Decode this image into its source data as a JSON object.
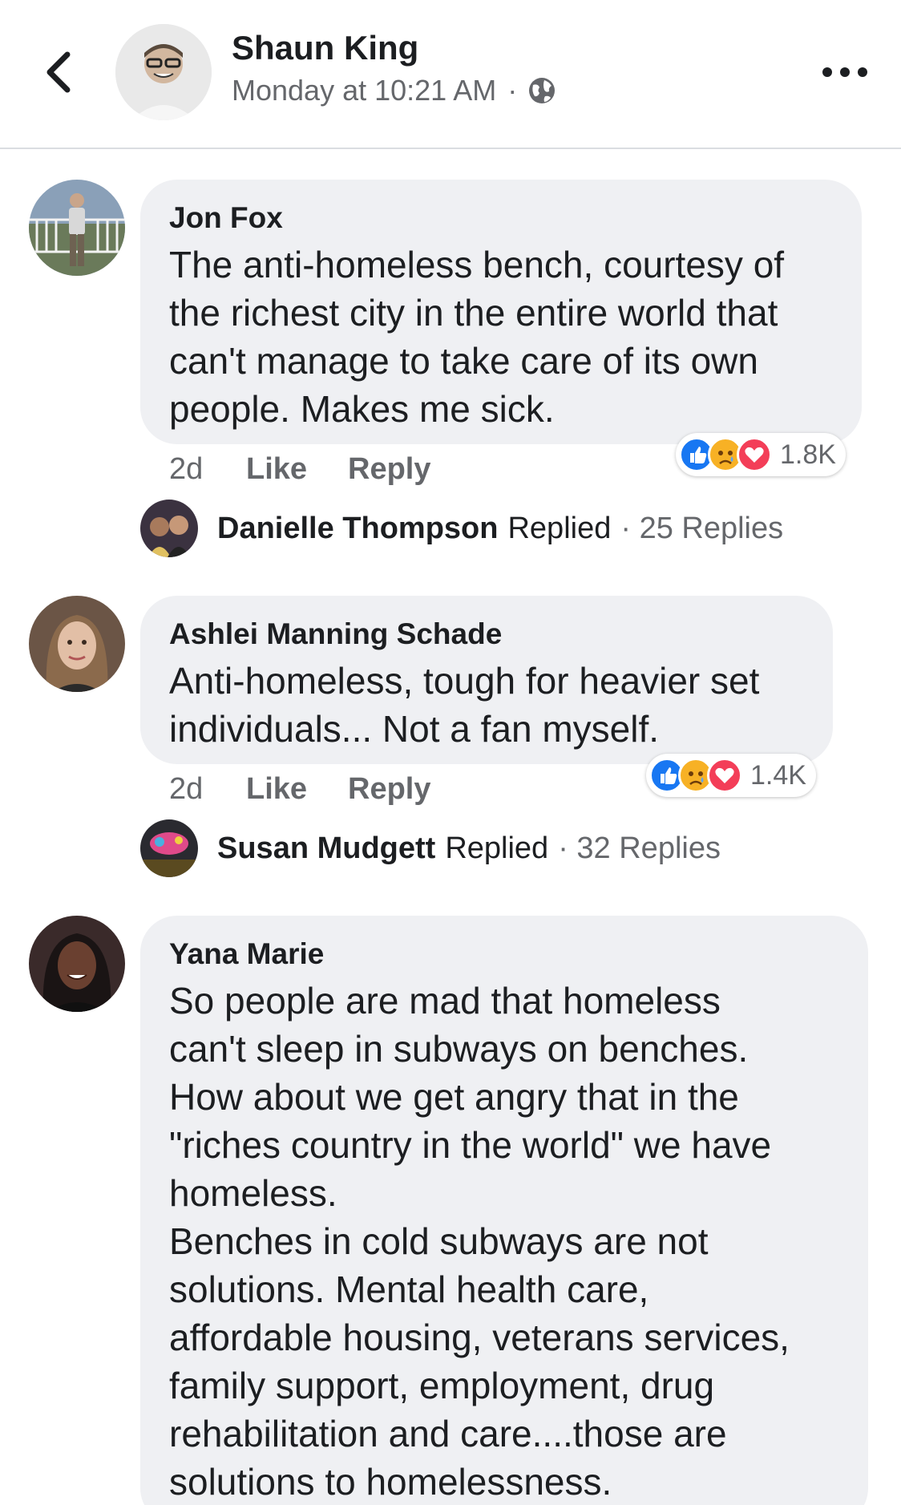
{
  "header": {
    "back_icon": "chevron-left-icon",
    "author": "Shaun King",
    "timestamp": "Monday at 10:21 AM",
    "separator": "·",
    "privacy_icon": "globe-icon",
    "more_icon": "more-horizontal-icon"
  },
  "comments": [
    {
      "author": "Jon Fox",
      "text": "The anti-homeless bench, courtesy of the richest city in the entire world that can't manage to take care of its own people. Makes me sick.",
      "age": "2d",
      "like_label": "Like",
      "reply_label": "Reply",
      "reactions": [
        "like",
        "sad",
        "love"
      ],
      "reaction_count": "1.8K",
      "replied_by": "Danielle Thompson",
      "replied_label": "Replied",
      "reply_count": "· 25 Replies"
    },
    {
      "author": "Ashlei Manning Schade",
      "text": "Anti-homeless, tough for heavier set individuals... Not a fan myself.",
      "age": "2d",
      "like_label": "Like",
      "reply_label": "Reply",
      "reactions": [
        "like",
        "sad",
        "love"
      ],
      "reaction_count": "1.4K",
      "replied_by": "Susan Mudgett",
      "replied_label": "Replied",
      "reply_count": "· 32 Replies"
    },
    {
      "author": "Yana Marie",
      "text_lines": [
        "So people are mad that homeless",
        "can't sleep in subways on benches.",
        "How about we get angry that in the",
        "\"riches country in the world\" we have",
        "homeless.",
        "Benches in cold subways are not",
        "solutions. Mental health care,",
        "affordable housing, veterans services,",
        "family support,  employment, drug",
        "rehabilitation and care....those are",
        "solutions to homelessness."
      ]
    }
  ],
  "colors": {
    "bubble": "#eff0f3",
    "like_blue": "#1877f2",
    "love_red": "#f33e58",
    "sad_yellow": "#f7b125",
    "secondary_text": "#65676b"
  }
}
